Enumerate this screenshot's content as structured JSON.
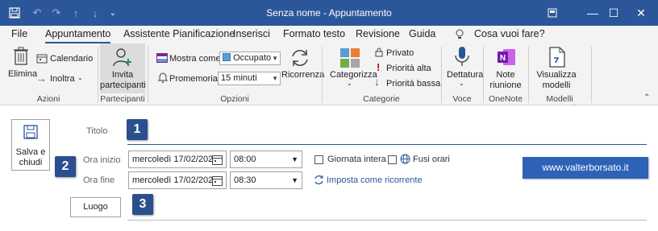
{
  "window": {
    "title": "Senza nome  -  Appuntamento",
    "restore_icon": "restore-icon",
    "minimize_symbol": "—",
    "maximize_symbol": "☐",
    "close_symbol": "✕"
  },
  "menu": {
    "tabs": [
      "File",
      "Appuntamento",
      "Assistente Pianificazione",
      "Inserisci",
      "Formato testo",
      "Revisione",
      "Guida"
    ],
    "active": "Appuntamento",
    "tell_me": "Cosa vuoi fare?"
  },
  "ribbon": {
    "azioni": {
      "elimina": "Elimina",
      "calendario": "Calendario",
      "inoltra": "Inoltra",
      "group": "Azioni"
    },
    "partecipanti": {
      "invita_line1": "Invita",
      "invita_line2": "partecipanti",
      "group": "Partecipanti"
    },
    "opzioni": {
      "mostra_come_label": "Mostra come:",
      "mostra_come_value": "Occupato",
      "promemoria_label": "Promemoria:",
      "promemoria_value": "15 minuti",
      "ricorrenza": "Ricorrenza",
      "group": "Opzioni"
    },
    "categorie": {
      "categorizza": "Categorizza",
      "privato": "Privato",
      "priorita_alta": "Priorità alta",
      "priorita_bassa": "Priorità bassa",
      "group": "Categorie"
    },
    "voce": {
      "dettatura": "Dettatura",
      "group": "Voce"
    },
    "onenote": {
      "line1": "Note",
      "line2": "riunione",
      "group": "OneNote"
    },
    "modelli": {
      "line1": "Visualizza",
      "line2": "modelli",
      "group": "Modelli personali"
    },
    "colors": {
      "occupato_swatch": "#5b9bd5",
      "priorita_alta": "#c00000",
      "priorita_bassa": "#2b579a",
      "onenote": "#7719aa"
    }
  },
  "form": {
    "salva_line1": "Salva e",
    "salva_line2": "chiudi",
    "titolo_label": "Titolo",
    "titolo_value": "",
    "ora_inizio_label": "Ora inizio",
    "ora_inizio_date": "mercoledì 17/02/202",
    "ora_inizio_time": "08:00",
    "ora_fine_label": "Ora fine",
    "ora_fine_date": "mercoledì 17/02/202",
    "ora_fine_time": "08:30",
    "giornata_intera": "Giornata intera",
    "fusi_orari": "Fusi orari",
    "imposta_ricorrente": "Imposta come ricorrente",
    "luogo_label": "Luogo",
    "luogo_value": "",
    "watermark": "www.valterborsato.it",
    "badges": [
      "1",
      "2",
      "3"
    ]
  }
}
